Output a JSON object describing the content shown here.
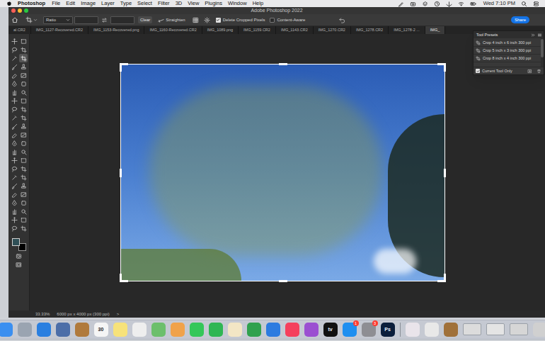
{
  "menu_bar": {
    "app": "Photoshop",
    "items": [
      "File",
      "Edit",
      "Image",
      "Layer",
      "Type",
      "Select",
      "Filter",
      "3D",
      "View",
      "Plugins",
      "Window",
      "Help"
    ],
    "clock": "Wed 7:10 PM"
  },
  "window": {
    "title": "Adobe Photoshop 2022"
  },
  "options_bar": {
    "aspect": "Ratio",
    "clear": "Clear",
    "straighten": "Straighten",
    "checkboxes": [
      {
        "label": "Delete Cropped Pixels",
        "checked": true
      },
      {
        "label": "Content-Aware",
        "checked": false
      }
    ],
    "share": "Share"
  },
  "tabs": [
    {
      "label": "al.CR2",
      "selected": false
    },
    {
      "label": "IMG_1127-Recovered.CR2",
      "selected": false
    },
    {
      "label": "IMG_1153-Recovered.png",
      "selected": false
    },
    {
      "label": "IMG_1160-Recovered.CR2",
      "selected": false
    },
    {
      "label": "IMG_1089.png",
      "selected": false
    },
    {
      "label": "IMG_1159.CR2",
      "selected": false
    },
    {
      "label": "IMG_1143.CR2",
      "selected": false
    },
    {
      "label": "IMG_1270.CR2",
      "selected": false
    },
    {
      "label": "IMG_1278.CR2",
      "selected": false
    },
    {
      "label": "IMG_1278-2 ...",
      "selected": false
    },
    {
      "label": "IMG_",
      "selected": true
    }
  ],
  "tool_presets": {
    "title": "Tool Presets",
    "items": [
      "Crop 4 inch x 6 inch 300 ppi",
      "Crop 5 inch x 3 inch 300 ppi",
      "Crop 8 inch x 4 inch 300 ppi"
    ],
    "current_tool_only": {
      "label": "Current Tool Only",
      "checked": true
    }
  },
  "tools": [
    {
      "selected": false
    },
    {
      "selected": false
    },
    {
      "selected": false
    },
    {
      "selected": false
    },
    {
      "selected": false
    },
    {
      "selected": true
    },
    {
      "selected": false
    },
    {
      "selected": false
    },
    {
      "selected": false
    },
    {
      "selected": false
    },
    {
      "selected": false
    },
    {
      "selected": false
    },
    {
      "selected": false
    },
    {
      "selected": false
    },
    {
      "selected": false
    },
    {
      "selected": false
    },
    {
      "selected": false
    },
    {
      "selected": false
    },
    {
      "selected": false
    },
    {
      "selected": false
    },
    {
      "selected": false
    },
    {
      "selected": false
    },
    {
      "selected": false
    },
    {
      "selected": false
    },
    {
      "selected": false
    },
    {
      "selected": false
    },
    {
      "selected": false
    },
    {
      "selected": false
    },
    {
      "selected": false
    },
    {
      "selected": false
    },
    {
      "selected": false
    },
    {
      "selected": false
    },
    {
      "selected": false
    },
    {
      "selected": false
    },
    {
      "selected": false
    },
    {
      "selected": false
    },
    {
      "selected": false
    },
    {
      "selected": false
    },
    {
      "selected": false
    },
    {
      "selected": false
    },
    {
      "selected": false
    },
    {
      "selected": false
    },
    {
      "selected": false
    },
    {
      "selected": false
    },
    {
      "selected": false
    },
    {
      "selected": false
    }
  ],
  "swatches": [
    {
      "color": "#2f4f56"
    },
    {
      "color": "#000000"
    }
  ],
  "status_bar": {
    "zoom": "33.33%",
    "info": "6000 px x 4000 px (300 ppi)",
    "arrow": ">"
  },
  "dock": [
    {
      "kind": "app",
      "color": "#3b8ff0"
    },
    {
      "kind": "app",
      "color": "#9aa4b1"
    },
    {
      "kind": "app",
      "color": "#2a7fe0"
    },
    {
      "kind": "app",
      "color": "#4c6ea8"
    },
    {
      "kind": "app",
      "color": "#b07a3c"
    },
    {
      "kind": "app",
      "color": "#f5f5f5",
      "label": "30"
    },
    {
      "kind": "app",
      "color": "#f7e27a"
    },
    {
      "kind": "app",
      "color": "#eeeeee"
    },
    {
      "kind": "app",
      "color": "#6cbf6c"
    },
    {
      "kind": "app",
      "color": "#f0a24a"
    },
    {
      "kind": "app",
      "color": "#34c759"
    },
    {
      "kind": "app",
      "color": "#2fb653"
    },
    {
      "kind": "app",
      "color": "#f3e6c5"
    },
    {
      "kind": "app",
      "color": "#30a14e"
    },
    {
      "kind": "app",
      "color": "#2d7be0"
    },
    {
      "kind": "app",
      "color": "#f5405d"
    },
    {
      "kind": "app",
      "color": "#9b4fd1"
    },
    {
      "kind": "app",
      "color": "#111111",
      "label": "tv"
    },
    {
      "kind": "app",
      "color": "#1e8ff0",
      "badge": "1"
    },
    {
      "kind": "app",
      "color": "#8e8e93",
      "badge": "3"
    },
    {
      "kind": "app",
      "color": "#0b1e3b",
      "label": "Ps"
    },
    {
      "kind": "separator"
    },
    {
      "kind": "app",
      "color": "#e9e4ea"
    },
    {
      "kind": "app",
      "color": "#e8e8e8"
    },
    {
      "kind": "app",
      "color": "#a0713a"
    },
    {
      "kind": "window",
      "color": "#dcdcdc"
    },
    {
      "kind": "window",
      "color": "#e4e4e4"
    },
    {
      "kind": "window",
      "color": "#d6d6d6"
    },
    {
      "kind": "app",
      "color": "#d0d0d0"
    }
  ]
}
